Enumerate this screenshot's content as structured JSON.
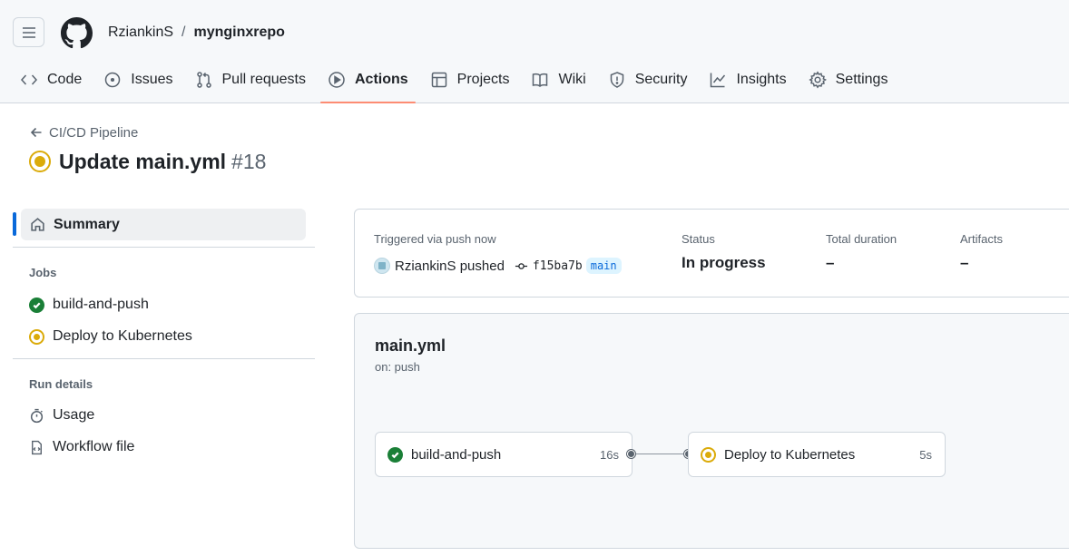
{
  "header": {
    "owner": "RziankinS",
    "separator": "/",
    "repo": "mynginxrepo"
  },
  "tabs": [
    {
      "label": "Code",
      "icon": "code-icon",
      "active": false
    },
    {
      "label": "Issues",
      "icon": "issue-icon",
      "active": false
    },
    {
      "label": "Pull requests",
      "icon": "pull-request-icon",
      "active": false
    },
    {
      "label": "Actions",
      "icon": "play-icon",
      "active": true
    },
    {
      "label": "Projects",
      "icon": "table-icon",
      "active": false
    },
    {
      "label": "Wiki",
      "icon": "book-icon",
      "active": false
    },
    {
      "label": "Security",
      "icon": "shield-icon",
      "active": false
    },
    {
      "label": "Insights",
      "icon": "graph-icon",
      "active": false
    },
    {
      "label": "Settings",
      "icon": "gear-icon",
      "active": false
    }
  ],
  "run": {
    "workflow_link": "CI/CD Pipeline",
    "title": "Update main.yml",
    "number": "#18",
    "status_icon": "in-progress-icon"
  },
  "sidebar": {
    "summary": "Summary",
    "jobs_heading": "Jobs",
    "jobs": [
      {
        "label": "build-and-push",
        "status": "success"
      },
      {
        "label": "Deploy to Kubernetes",
        "status": "in_progress"
      }
    ],
    "run_details_heading": "Run details",
    "details": [
      {
        "label": "Usage",
        "icon": "stopwatch-icon"
      },
      {
        "label": "Workflow file",
        "icon": "file-code-icon"
      }
    ]
  },
  "summary_card": {
    "triggered": "Triggered via push now",
    "pusher": "RziankinS pushed",
    "commit": "f15ba7b",
    "branch": "main",
    "status_label": "Status",
    "status_value": "In progress",
    "duration_label": "Total duration",
    "duration_value": "–",
    "artifacts_label": "Artifacts",
    "artifacts_value": "–"
  },
  "workflow": {
    "file": "main.yml",
    "on": "on: push",
    "jobs": [
      {
        "name": "build-and-push",
        "duration": "16s",
        "status": "success"
      },
      {
        "name": "Deploy to Kubernetes",
        "duration": "5s",
        "status": "in_progress"
      }
    ]
  },
  "colors": {
    "success": "#1a7f37",
    "in_progress": "#dbab0a",
    "active_tab_underline": "#fd8c73",
    "accent": "#0969da"
  }
}
